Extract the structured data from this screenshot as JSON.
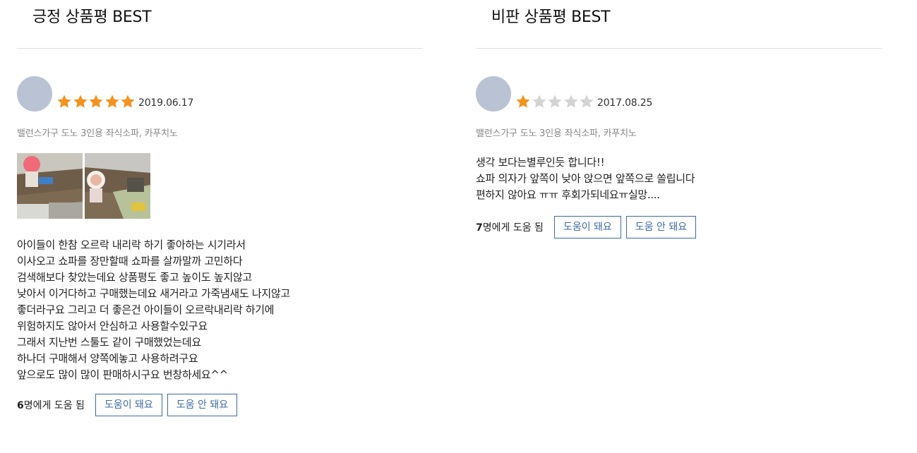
{
  "positive": {
    "title": "긍정 상품평 BEST",
    "review": {
      "rating": 5,
      "max_rating": 5,
      "date": "2019.06.17",
      "product": "밸런스가구 도노 3인용 좌식소파, 카푸치노",
      "photos": [
        "photo-1",
        "photo-2"
      ],
      "lines": [
        "아이들이 한참 오르락 내리락 하기 좋아하는 시기라서",
        "이사오고 쇼파를 장만할때 쇼파를 살까말까 고민하다",
        "검색해보다 찾았는데요 상품평도 좋고 높이도 높지않고",
        "낮아서 이거다하고 구매했는데요 새거라고 가죽냄새도 나지않고",
        "좋더라구요 그리고 더 좋은건 아이들이 오르락내리락 하기에",
        "위험하지도 않아서 안심하고 사용할수있구요",
        "그래서 지난번 스툴도 같이 구매했었는데요",
        "하나더 구매해서 양쪽에놓고 사용하려구요",
        "앞으로도 많이 많이 판매하시구요 번창하세요^^"
      ],
      "helpful_count": "6",
      "helpful_suffix": "명에게 도움 됨",
      "helpful_yes": "도움이 돼요",
      "helpful_no": "도움 안 돼요"
    }
  },
  "critical": {
    "title": "비판 상품평 BEST",
    "review": {
      "rating": 1,
      "max_rating": 5,
      "date": "2017.08.25",
      "product": "밸런스가구 도노 3인용 좌식소파, 카푸치노",
      "lines": [
        "생각 보다는별루인듯 합니다!!",
        "쇼파 의자가 앞쪽이 낮아 앉으면 앞쪽으로 쏠립니다",
        "편하지 않아요 ㅠㅠ 후회가되네요ㅠ실망...."
      ],
      "helpful_count": "7",
      "helpful_suffix": "명에게 도움 됨",
      "helpful_yes": "도움이 돼요",
      "helpful_no": "도움 안 돼요"
    }
  },
  "colors": {
    "star_filled": "#f5921e",
    "star_empty": "#d4d4d4",
    "button_border": "#3d6aa8",
    "avatar": "#b9c3d3"
  }
}
